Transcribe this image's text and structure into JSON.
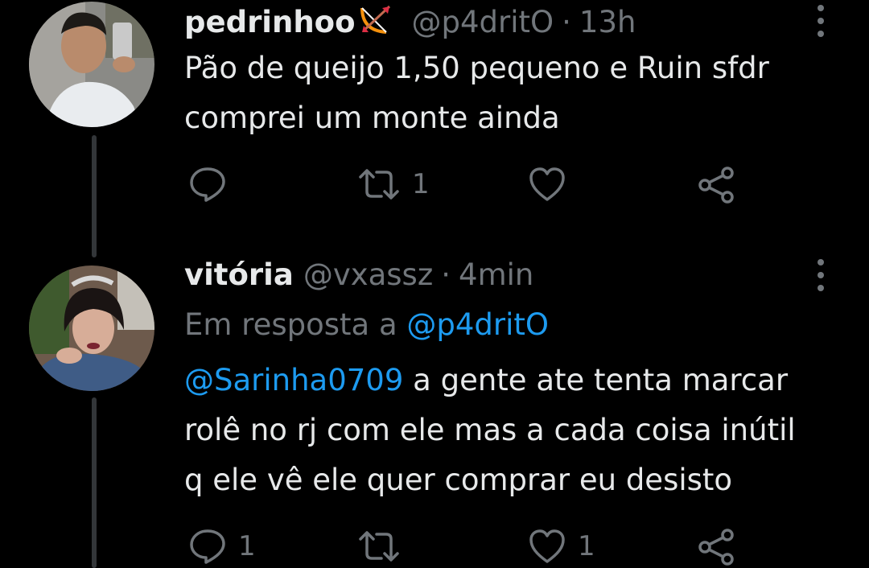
{
  "tweets": [
    {
      "display_name": "pedrinhoo",
      "name_emoji_icon": "bow-and-arrow-icon",
      "handle": "@p4dritO",
      "dot": "·",
      "time": "13h",
      "text_lines": [
        "Pão de queijo 1,50 pequeno e Ruin sfdr",
        "comprei um monte ainda"
      ],
      "actions": {
        "reply_count": "",
        "retweet_count": "1",
        "like_count": "",
        "share_icon": "share-icon"
      }
    },
    {
      "display_name": "vitória",
      "handle": "@vxassz",
      "dot": "·",
      "time": "4min",
      "reply_to_prefix": "Em resposta a",
      "reply_to_handle": "@p4dritO",
      "text_mention": "@Sarinha0709",
      "text_first_rest": " a gente ate tenta marcar",
      "text_lines": [
        "rolê no rj com ele mas a cada coisa inútil",
        "q ele vê ele quer comprar eu desisto"
      ],
      "actions": {
        "reply_count": "1",
        "retweet_count": "",
        "like_count": "1",
        "share_icon": "share-icon"
      }
    }
  ],
  "colors": {
    "background": "#000000",
    "text": "#e7e9ea",
    "secondary": "#71767b",
    "link": "#1d9bf0",
    "thread_line": "#333639"
  }
}
